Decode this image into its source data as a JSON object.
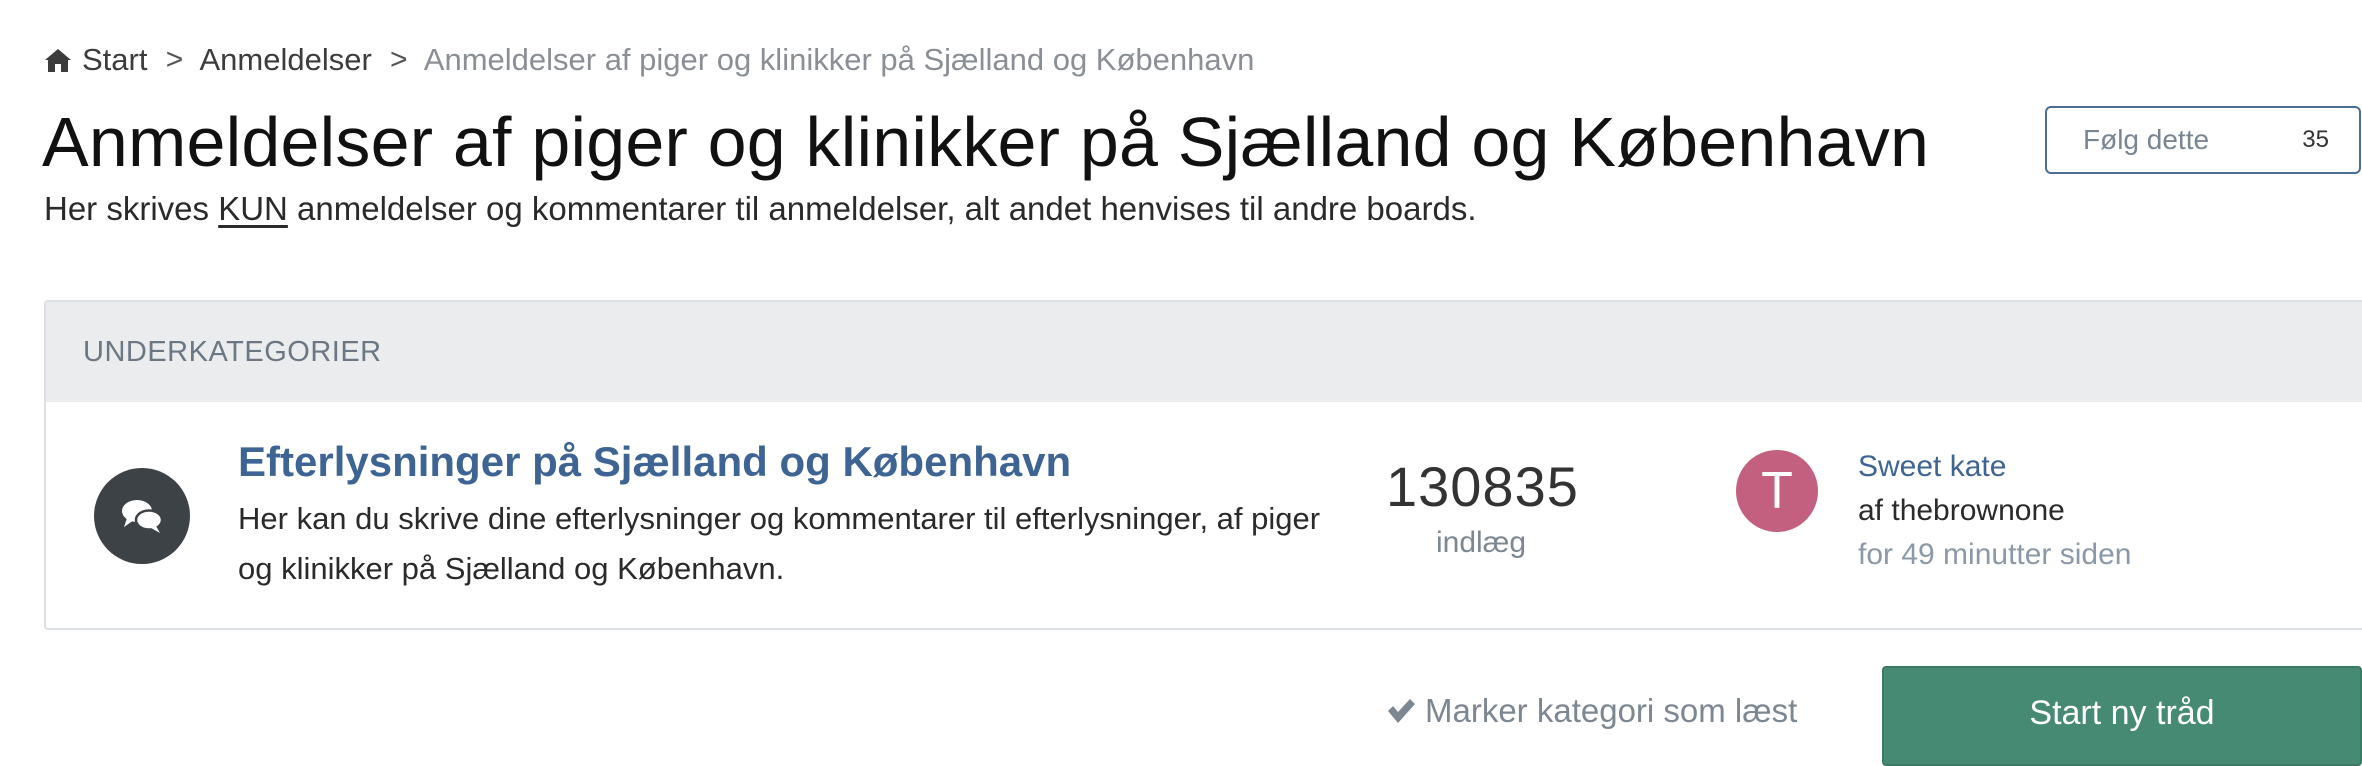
{
  "breadcrumb": {
    "items": [
      {
        "label": "Start",
        "icon": "home-icon"
      },
      {
        "label": "Anmeldelser"
      },
      {
        "label": "Anmeldelser af piger og klinikker på Sjælland og København"
      }
    ],
    "separator": ">"
  },
  "page": {
    "title": "Anmeldelser af piger og klinikker på Sjælland og København",
    "description_before": "Her skrives ",
    "description_emphasis": "KUN",
    "description_after": " anmeldelser og kommentarer til anmeldelser, alt andet henvises til andre boards."
  },
  "follow": {
    "label": "Følg dette",
    "count": "35"
  },
  "subcategories": {
    "header": "UNDERKATEGORIER",
    "forums": [
      {
        "icon": "chat-bubbles-icon",
        "title": "Efterlysninger på Sjælland og København",
        "description": "Her kan du skrive dine efterlysninger og kommentarer til efterlysninger, af piger og klinikker på Sjælland og København.",
        "post_count": "130835",
        "post_count_label": "indlæg",
        "last_post": {
          "avatar_letter": "T",
          "avatar_color": "#c4607f",
          "title": "Sweet kate",
          "author": "af thebrownone",
          "time": "for 49 minutter siden"
        }
      }
    ]
  },
  "actions": {
    "mark_read_label": "Marker kategori som læst",
    "start_thread_label": "Start ny tråd"
  },
  "colors": {
    "link": "#3e6494",
    "primary_button": "#478a73",
    "header_bg": "#ebecee"
  }
}
